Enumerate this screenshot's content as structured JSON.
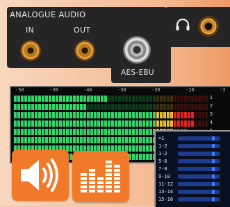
{
  "io_panel": {
    "analogue_title": "ANALOGUE AUDIO",
    "in_label": "IN",
    "out_label": "OUT",
    "aes_label": "AES-EBU"
  },
  "meter": {
    "scale_labels": [
      "-50",
      "-30",
      "-40",
      "-30",
      "-30",
      "-10",
      "-3"
    ],
    "channel_numbers": [
      "1",
      "2",
      "3",
      "4",
      "5",
      "6",
      "7",
      "8"
    ]
  },
  "inset": {
    "rows": [
      "=1",
      "1-2",
      "1-2",
      "5-6",
      "7-8",
      "9-10",
      "11-12",
      "13-14",
      "15-16"
    ]
  },
  "colors": {
    "accent": "#f07a2a",
    "panel": "#252525",
    "meter_green": "#22c25a",
    "meter_red": "#d41f1f"
  }
}
